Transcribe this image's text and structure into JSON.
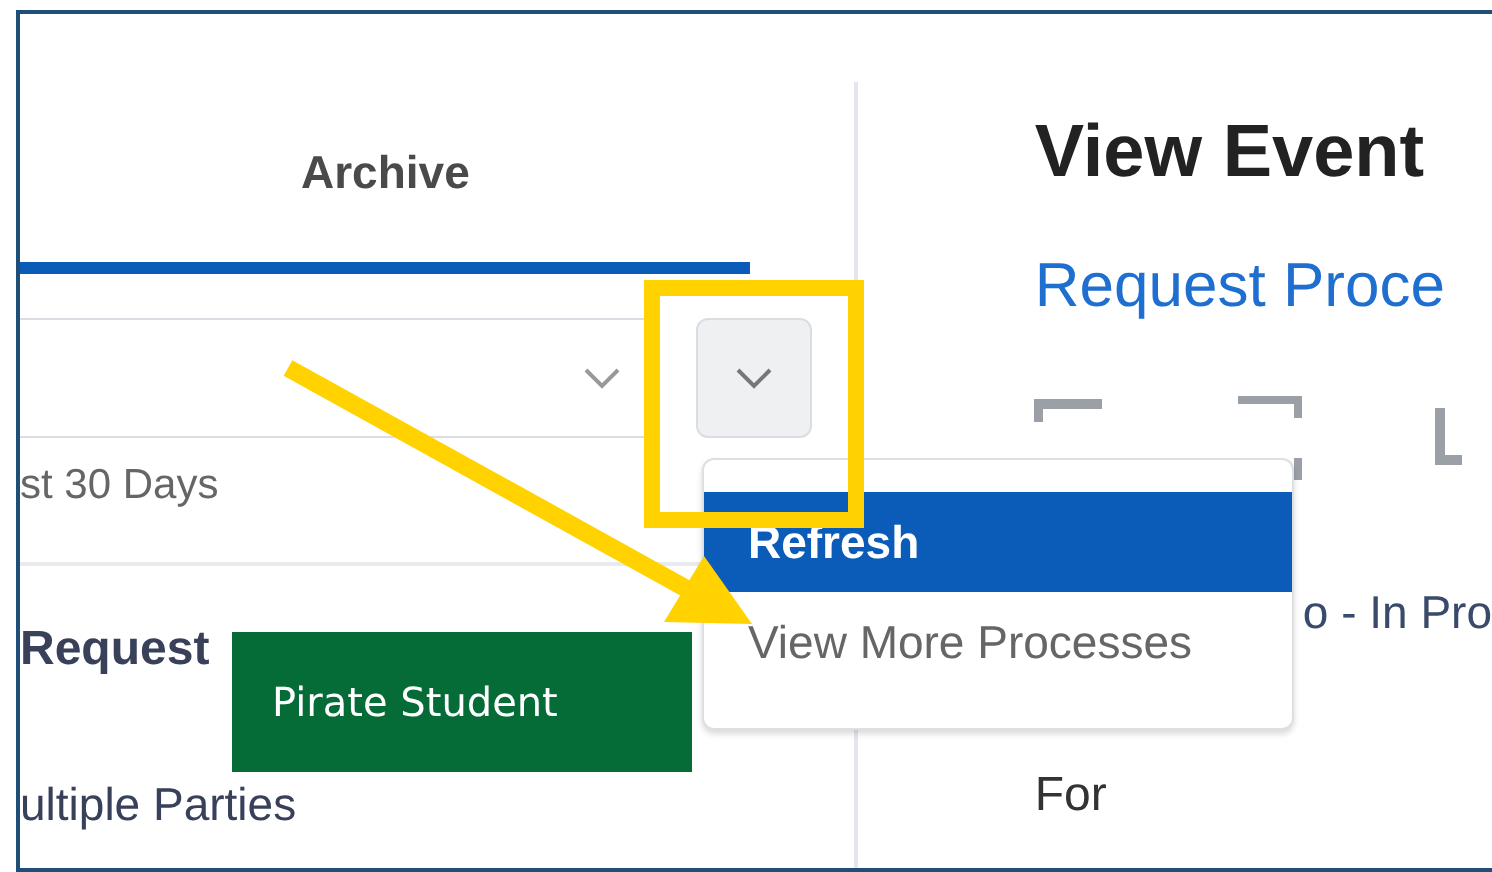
{
  "tabs": [
    {
      "label": "Archive",
      "selected": true
    }
  ],
  "filter": {
    "period": "st 30 Days"
  },
  "list_item": {
    "title": "Request",
    "subtitle": "ultiple Parties"
  },
  "menu": {
    "items": [
      {
        "label": "Refresh",
        "selected": true
      },
      {
        "label": "View More Processes",
        "selected": false
      }
    ]
  },
  "page": {
    "title": "View Event",
    "subtitle": "Request Proce",
    "status": "o - In Pro",
    "section": "For"
  },
  "annotation": {
    "label": "Pirate Student"
  }
}
